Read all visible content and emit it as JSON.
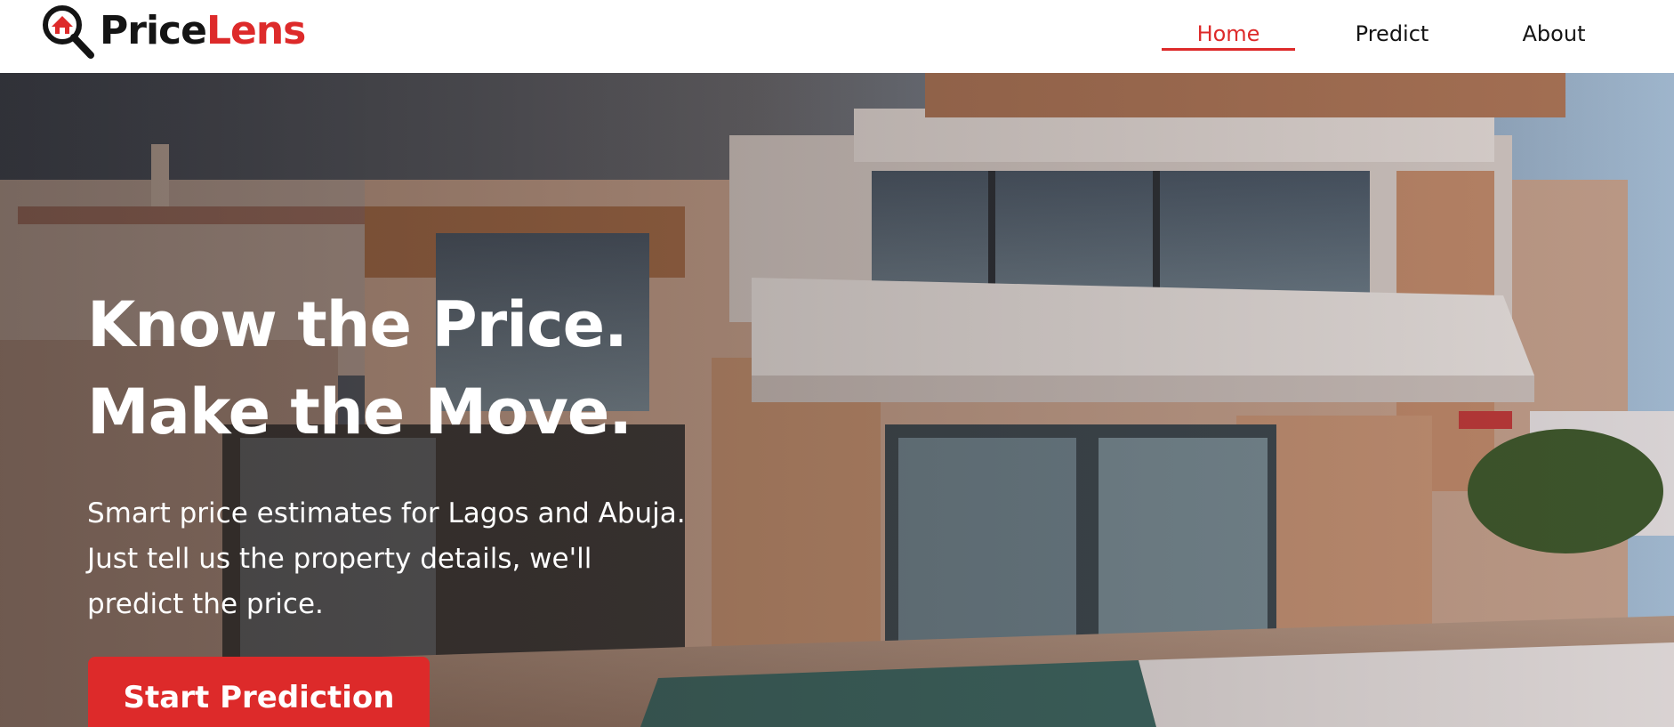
{
  "brand": {
    "name_part1": "Price",
    "name_part2": "Lens",
    "logo_icon": "magnifier-house-icon",
    "colors": {
      "dark": "#141414",
      "accent": "#dd2a2a"
    }
  },
  "nav": {
    "items": [
      {
        "label": "Home",
        "active": true
      },
      {
        "label": "Predict",
        "active": false
      },
      {
        "label": "About",
        "active": false
      }
    ]
  },
  "hero": {
    "headline_line1": "Know the Price.",
    "headline_line2": "Make the Move.",
    "subtext": "Smart price estimates for Lagos and Abuja. Just tell us the property details, we'll predict the price.",
    "cta_label": "Start Prediction",
    "background": "modern-villa-photo"
  }
}
